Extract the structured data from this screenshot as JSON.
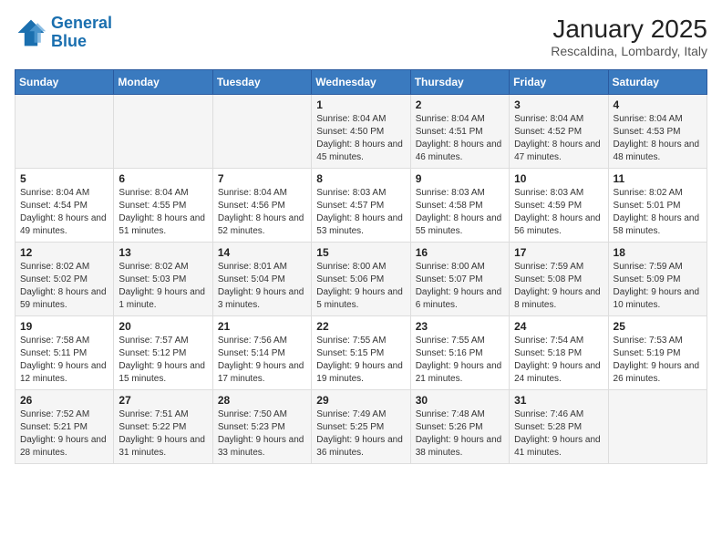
{
  "logo": {
    "line1": "General",
    "line2": "Blue"
  },
  "title": "January 2025",
  "subtitle": "Rescaldina, Lombardy, Italy",
  "days_of_week": [
    "Sunday",
    "Monday",
    "Tuesday",
    "Wednesday",
    "Thursday",
    "Friday",
    "Saturday"
  ],
  "weeks": [
    [
      {
        "day": "",
        "info": ""
      },
      {
        "day": "",
        "info": ""
      },
      {
        "day": "",
        "info": ""
      },
      {
        "day": "1",
        "info": "Sunrise: 8:04 AM\nSunset: 4:50 PM\nDaylight: 8 hours\nand 45 minutes."
      },
      {
        "day": "2",
        "info": "Sunrise: 8:04 AM\nSunset: 4:51 PM\nDaylight: 8 hours\nand 46 minutes."
      },
      {
        "day": "3",
        "info": "Sunrise: 8:04 AM\nSunset: 4:52 PM\nDaylight: 8 hours\nand 47 minutes."
      },
      {
        "day": "4",
        "info": "Sunrise: 8:04 AM\nSunset: 4:53 PM\nDaylight: 8 hours\nand 48 minutes."
      }
    ],
    [
      {
        "day": "5",
        "info": "Sunrise: 8:04 AM\nSunset: 4:54 PM\nDaylight: 8 hours\nand 49 minutes."
      },
      {
        "day": "6",
        "info": "Sunrise: 8:04 AM\nSunset: 4:55 PM\nDaylight: 8 hours\nand 51 minutes."
      },
      {
        "day": "7",
        "info": "Sunrise: 8:04 AM\nSunset: 4:56 PM\nDaylight: 8 hours\nand 52 minutes."
      },
      {
        "day": "8",
        "info": "Sunrise: 8:03 AM\nSunset: 4:57 PM\nDaylight: 8 hours\nand 53 minutes."
      },
      {
        "day": "9",
        "info": "Sunrise: 8:03 AM\nSunset: 4:58 PM\nDaylight: 8 hours\nand 55 minutes."
      },
      {
        "day": "10",
        "info": "Sunrise: 8:03 AM\nSunset: 4:59 PM\nDaylight: 8 hours\nand 56 minutes."
      },
      {
        "day": "11",
        "info": "Sunrise: 8:02 AM\nSunset: 5:01 PM\nDaylight: 8 hours\nand 58 minutes."
      }
    ],
    [
      {
        "day": "12",
        "info": "Sunrise: 8:02 AM\nSunset: 5:02 PM\nDaylight: 8 hours\nand 59 minutes."
      },
      {
        "day": "13",
        "info": "Sunrise: 8:02 AM\nSunset: 5:03 PM\nDaylight: 9 hours\nand 1 minute."
      },
      {
        "day": "14",
        "info": "Sunrise: 8:01 AM\nSunset: 5:04 PM\nDaylight: 9 hours\nand 3 minutes."
      },
      {
        "day": "15",
        "info": "Sunrise: 8:00 AM\nSunset: 5:06 PM\nDaylight: 9 hours\nand 5 minutes."
      },
      {
        "day": "16",
        "info": "Sunrise: 8:00 AM\nSunset: 5:07 PM\nDaylight: 9 hours\nand 6 minutes."
      },
      {
        "day": "17",
        "info": "Sunrise: 7:59 AM\nSunset: 5:08 PM\nDaylight: 9 hours\nand 8 minutes."
      },
      {
        "day": "18",
        "info": "Sunrise: 7:59 AM\nSunset: 5:09 PM\nDaylight: 9 hours\nand 10 minutes."
      }
    ],
    [
      {
        "day": "19",
        "info": "Sunrise: 7:58 AM\nSunset: 5:11 PM\nDaylight: 9 hours\nand 12 minutes."
      },
      {
        "day": "20",
        "info": "Sunrise: 7:57 AM\nSunset: 5:12 PM\nDaylight: 9 hours\nand 15 minutes."
      },
      {
        "day": "21",
        "info": "Sunrise: 7:56 AM\nSunset: 5:14 PM\nDaylight: 9 hours\nand 17 minutes."
      },
      {
        "day": "22",
        "info": "Sunrise: 7:55 AM\nSunset: 5:15 PM\nDaylight: 9 hours\nand 19 minutes."
      },
      {
        "day": "23",
        "info": "Sunrise: 7:55 AM\nSunset: 5:16 PM\nDaylight: 9 hours\nand 21 minutes."
      },
      {
        "day": "24",
        "info": "Sunrise: 7:54 AM\nSunset: 5:18 PM\nDaylight: 9 hours\nand 24 minutes."
      },
      {
        "day": "25",
        "info": "Sunrise: 7:53 AM\nSunset: 5:19 PM\nDaylight: 9 hours\nand 26 minutes."
      }
    ],
    [
      {
        "day": "26",
        "info": "Sunrise: 7:52 AM\nSunset: 5:21 PM\nDaylight: 9 hours\nand 28 minutes."
      },
      {
        "day": "27",
        "info": "Sunrise: 7:51 AM\nSunset: 5:22 PM\nDaylight: 9 hours\nand 31 minutes."
      },
      {
        "day": "28",
        "info": "Sunrise: 7:50 AM\nSunset: 5:23 PM\nDaylight: 9 hours\nand 33 minutes."
      },
      {
        "day": "29",
        "info": "Sunrise: 7:49 AM\nSunset: 5:25 PM\nDaylight: 9 hours\nand 36 minutes."
      },
      {
        "day": "30",
        "info": "Sunrise: 7:48 AM\nSunset: 5:26 PM\nDaylight: 9 hours\nand 38 minutes."
      },
      {
        "day": "31",
        "info": "Sunrise: 7:46 AM\nSunset: 5:28 PM\nDaylight: 9 hours\nand 41 minutes."
      },
      {
        "day": "",
        "info": ""
      }
    ]
  ]
}
